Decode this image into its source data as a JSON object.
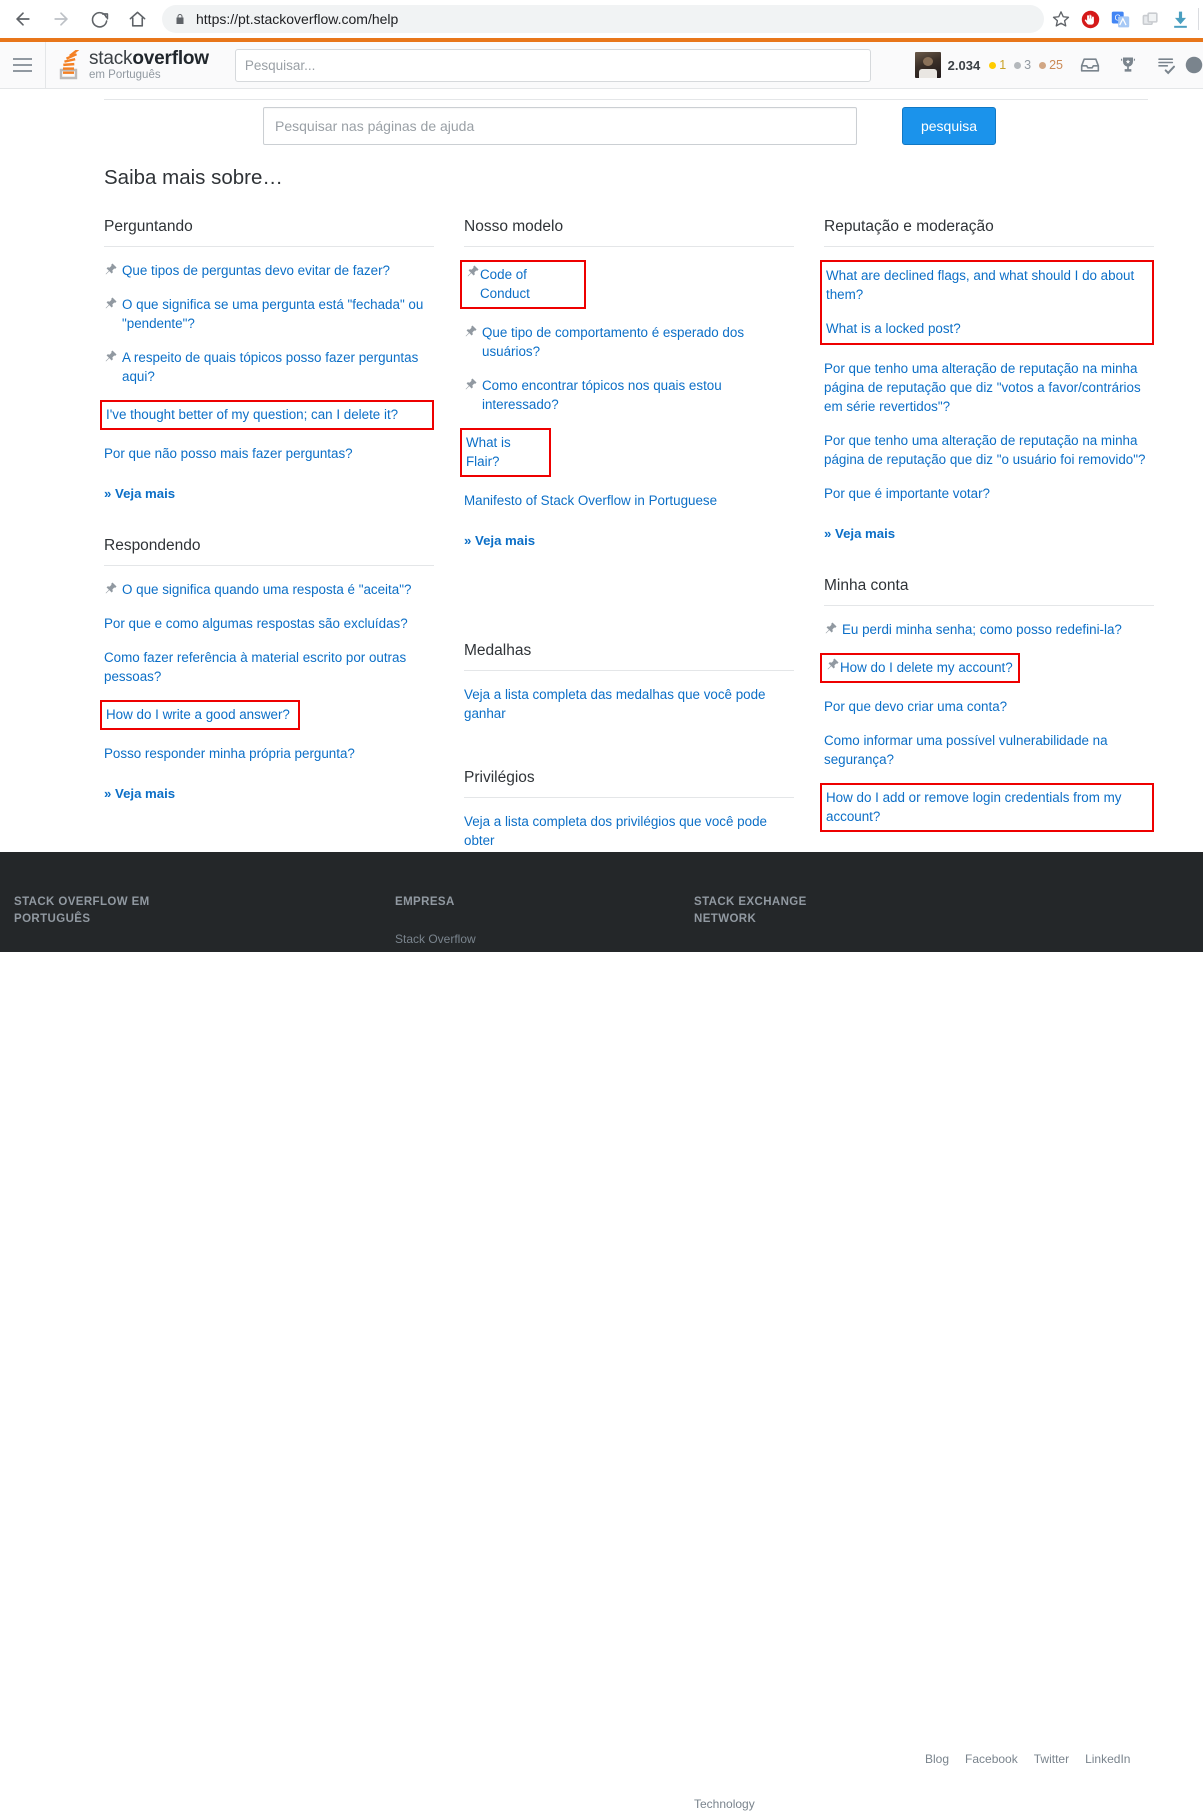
{
  "browser": {
    "url": "https://pt.stackoverflow.com/help",
    "back_icon": "back-arrow-icon",
    "forward_icon": "forward-arrow-icon",
    "reload_icon": "reload-icon",
    "home_icon": "home-icon",
    "lock_icon": "lock-icon",
    "star_icon": "star-icon",
    "extensions": [
      "adblock-icon",
      "google-translate-icon",
      "tabs-icon",
      "download-icon"
    ]
  },
  "topnav": {
    "hamburger": "hamburger-icon",
    "logo_line1_light": "stack",
    "logo_line1_bold": "overflow",
    "logo_line2": "em Português",
    "search_placeholder": "Pesquisar...",
    "reputation": "2.034",
    "badges": {
      "gold": "1",
      "silver": "3",
      "bronze": "25"
    },
    "icons": [
      "inbox-icon",
      "trophy-icon",
      "review-icon",
      "profile-icon"
    ],
    "colors": {
      "gold": "#ffcc01",
      "silver": "#b4b8bc",
      "bronze": "#d1a684",
      "brand_orange": "#e8761a"
    }
  },
  "help": {
    "search_placeholder": "Pesquisar nas páginas de ajuda",
    "search_value": "",
    "search_button": "pesquisa",
    "heading": "Saiba mais sobre…",
    "accent_blue": "#1b93eb",
    "link_blue": "#0c6fc7",
    "highlight_red": "#ee0000"
  },
  "columns": [
    {
      "title": "Perguntando",
      "items": [
        {
          "text": "Que tipos de perguntas devo evitar de fazer?",
          "pinned": true,
          "highlighted": false
        },
        {
          "text": "O que significa se uma pergunta está \"fechada\" ou \"pendente\"?",
          "pinned": true,
          "highlighted": false
        },
        {
          "text": "A respeito de quais tópicos posso fazer perguntas aqui?",
          "pinned": true,
          "highlighted": false
        },
        {
          "text": "I've thought better of my question; can I delete it?",
          "pinned": false,
          "highlighted": true
        },
        {
          "text": "Por que não posso mais fazer perguntas?",
          "pinned": false,
          "highlighted": false
        }
      ],
      "more": "» Veja mais"
    },
    {
      "title": "Nosso modelo",
      "items": [
        {
          "text": "Code of Conduct",
          "pinned": true,
          "highlighted": true
        },
        {
          "text": "Que tipo de comportamento é esperado dos usuários?",
          "pinned": true,
          "highlighted": false
        },
        {
          "text": "Como encontrar tópicos nos quais estou interessado?",
          "pinned": true,
          "highlighted": false
        },
        {
          "text": "What is Flair?",
          "pinned": false,
          "highlighted": true
        },
        {
          "text": "Manifesto of Stack Overflow in Portuguese",
          "pinned": false,
          "highlighted": false
        }
      ],
      "more": "» Veja mais"
    },
    {
      "title": "Reputação e moderação",
      "items": [
        {
          "text": "What are declined flags, and what should I do about them?",
          "pinned": false,
          "highlighted": true,
          "group": 1
        },
        {
          "text": "What is a locked post?",
          "pinned": false,
          "highlighted": true,
          "group": 1
        },
        {
          "text": "Por que tenho uma alteração de reputação na minha página de reputação que diz \"votos a favor/contrários em série revertidos\"?",
          "pinned": false,
          "highlighted": false
        },
        {
          "text": "Por que tenho uma alteração de reputação na minha página de reputação que diz \"o usuário foi removido\"?",
          "pinned": false,
          "highlighted": false
        },
        {
          "text": "Por que é importante votar?",
          "pinned": false,
          "highlighted": false
        }
      ],
      "more": "» Veja mais"
    },
    {
      "title": "Respondendo",
      "items": [
        {
          "text": "O que significa quando uma resposta é \"aceita\"?",
          "pinned": true,
          "highlighted": false
        },
        {
          "text": "Por que e como algumas respostas são excluídas?",
          "pinned": false,
          "highlighted": false
        },
        {
          "text": "Como fazer referência à material escrito por outras pessoas?",
          "pinned": false,
          "highlighted": false
        },
        {
          "text": "How do I write a good answer?",
          "pinned": false,
          "highlighted": true
        },
        {
          "text": "Posso responder minha própria pergunta?",
          "pinned": false,
          "highlighted": false
        }
      ],
      "more": "» Veja mais"
    },
    {
      "title": "Medalhas",
      "items": [
        {
          "text": "Veja a lista completa das medalhas que você pode ganhar",
          "pinned": false,
          "highlighted": false
        }
      ],
      "more": ""
    },
    {
      "title": "Privilégios",
      "items": [
        {
          "text": "Veja a lista completa dos privilégios que você pode obter",
          "pinned": false,
          "highlighted": false
        }
      ],
      "more": ""
    },
    {
      "title": "Minha conta",
      "items": [
        {
          "text": "Eu perdi minha senha; como posso redefini-la?",
          "pinned": true,
          "highlighted": false
        },
        {
          "text": "How do I delete my account?",
          "pinned": true,
          "highlighted": true
        },
        {
          "text": "Por que devo criar uma conta?",
          "pinned": false,
          "highlighted": false
        },
        {
          "text": "Como informar uma possível vulnerabilidade na segurança?",
          "pinned": false,
          "highlighted": false
        },
        {
          "text": "How do I add or remove login credentials from my account?",
          "pinned": false,
          "highlighted": true
        }
      ],
      "more": "» Veja mais"
    }
  ],
  "footer": {
    "col1_title": "STACK OVERFLOW EM PORTUGUÊS",
    "col2_title": "EMPRESA",
    "col2_link1": "Stack Overflow",
    "col3_title": "STACK EXCHANGE NETWORK",
    "col3_link1": "Technology",
    "social": [
      "Blog",
      "Facebook",
      "Twitter",
      "LinkedIn"
    ],
    "background": "#242729"
  }
}
